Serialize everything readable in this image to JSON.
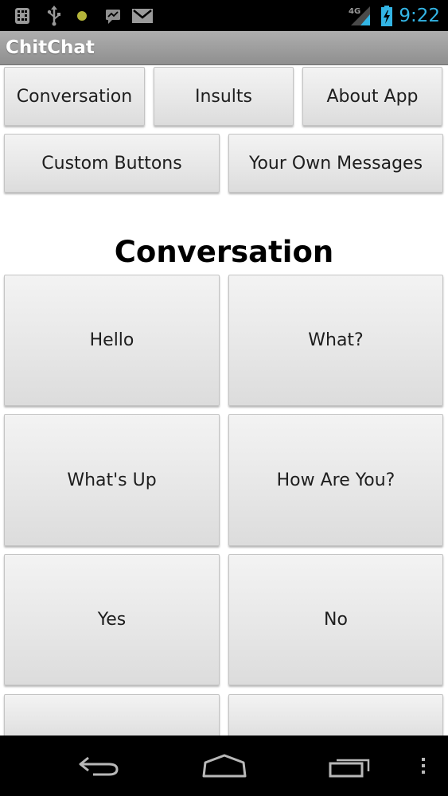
{
  "status_bar": {
    "time": "9:22",
    "network": "4G",
    "icons": [
      "android-debug-icon",
      "usb-icon",
      "notification-dot-icon",
      "chat-icon",
      "gmail-icon",
      "signal-icon",
      "battery-icon"
    ],
    "accent_color": "#33b5e5"
  },
  "app": {
    "title": "ChitChat"
  },
  "nav_buttons": [
    {
      "label": "Conversation"
    },
    {
      "label": "Insults"
    },
    {
      "label": "About App"
    },
    {
      "label": "Custom Buttons"
    },
    {
      "label": "Your Own Messages"
    }
  ],
  "section": {
    "title": "Conversation"
  },
  "message_buttons": [
    {
      "label": "Hello"
    },
    {
      "label": "What?"
    },
    {
      "label": "What's Up"
    },
    {
      "label": "How Are You?"
    },
    {
      "label": "Yes"
    },
    {
      "label": "No"
    },
    {
      "label": ""
    },
    {
      "label": ""
    }
  ],
  "system_nav": {
    "icons": [
      "back-icon",
      "home-icon",
      "recent-apps-icon",
      "menu-icon"
    ]
  }
}
